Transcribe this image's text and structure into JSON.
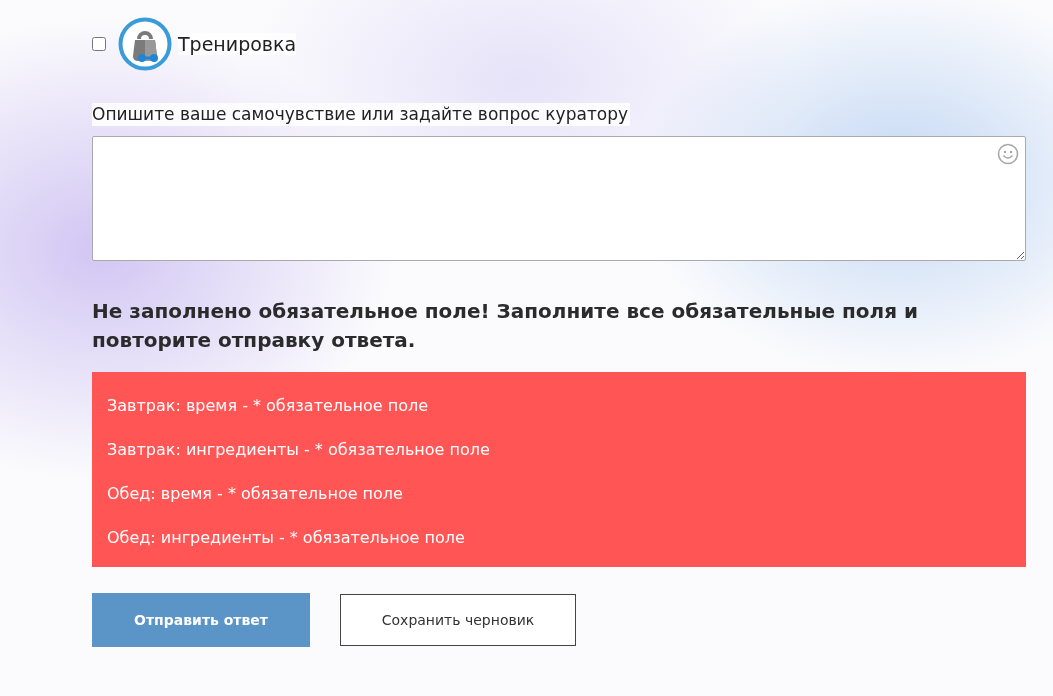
{
  "task": {
    "label": "Тренировка",
    "checked": false
  },
  "comment": {
    "label": "Опишите ваше самочувствие или задайте вопрос куратору"
  },
  "error": {
    "message": "Не заполнено обязательное поле! Заполните все обязательные поля и повторите отправку ответа.",
    "items": [
      "Завтрак: время - * обязательное поле",
      "Завтрак: ингредиенты - * обязательное поле",
      "Обед: время - * обязательное поле",
      "Обед: ингредиенты - * обязательное поле"
    ]
  },
  "buttons": [
    {
      "label": "Отправить ответ",
      "kind": "primary"
    },
    {
      "label": "Сохранить черновик",
      "kind": "secondary"
    }
  ]
}
